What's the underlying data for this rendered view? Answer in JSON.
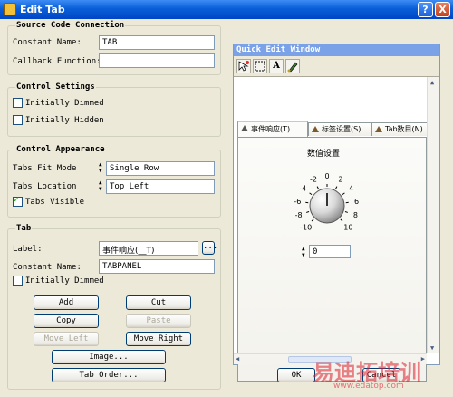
{
  "window": {
    "title": "Edit Tab",
    "help": "?",
    "close": "X"
  },
  "source_code": {
    "legend": "Source Code Connection",
    "constant_name_label": "Constant Name:",
    "constant_name_value": "TAB",
    "callback_label": "Callback Function:",
    "callback_value": ""
  },
  "control_settings": {
    "legend": "Control Settings",
    "initially_dimmed": "Initially Dimmed",
    "initially_hidden": "Initially Hidden"
  },
  "control_appearance": {
    "legend": "Control Appearance",
    "tabs_fit_mode_label": "Tabs Fit Mode",
    "tabs_fit_mode_value": "Single Row",
    "tabs_location_label": "Tabs Location",
    "tabs_location_value": "Top Left",
    "tabs_visible": "Tabs Visible"
  },
  "tab": {
    "legend": "Tab",
    "label_label": "Label:",
    "label_value": "事件响应(__T)",
    "browse": "...",
    "constant_name_label": "Constant Name:",
    "constant_name_value": "TABPANEL",
    "initially_dimmed": "Initially Dimmed",
    "buttons": {
      "add": "Add",
      "cut": "Cut",
      "copy": "Copy",
      "paste": "Paste",
      "move_left": "Move Left",
      "move_right": "Move Right",
      "image": "Image...",
      "tab_order": "Tab Order..."
    }
  },
  "quick_edit": {
    "title": "Quick Edit Window",
    "tabs": [
      "事件响应(T)",
      "标签设置(S)",
      "Tab数目(N)"
    ],
    "knob_title": "数值设置",
    "knob_labels": [
      "-10",
      "-8",
      "-6",
      "-4",
      "-2",
      "0",
      "2",
      "4",
      "6",
      "8",
      "10"
    ],
    "numeric_value": "0"
  },
  "footer": {
    "ok": "OK",
    "cancel": "Cancel"
  },
  "watermark": {
    "brand": "易迪拓培训",
    "url": "www.edatop.com"
  }
}
